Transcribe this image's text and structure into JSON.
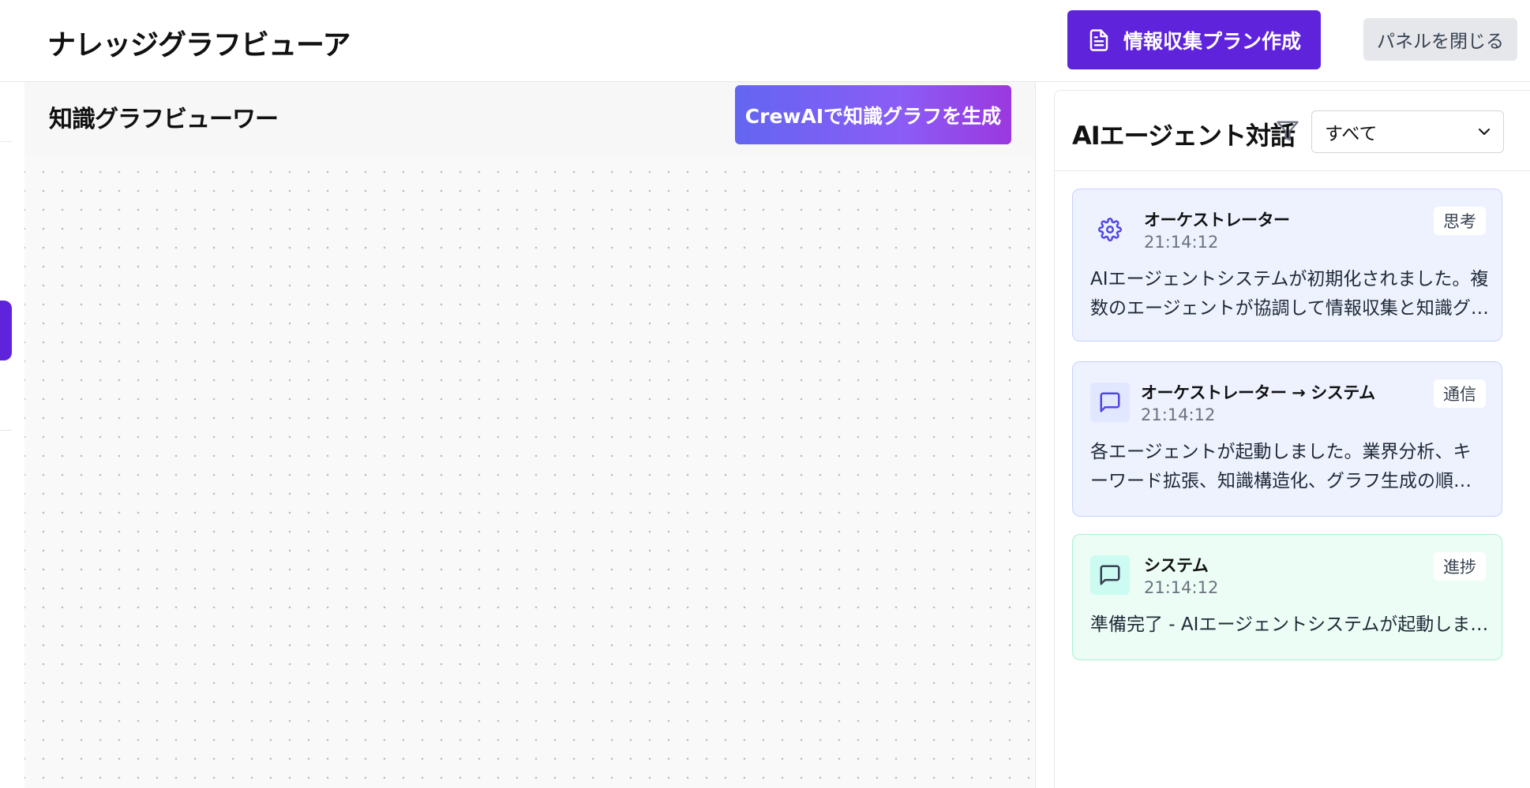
{
  "header": {
    "title": "ナレッジグラフビューア",
    "plan_button": "情報収集プラン作成",
    "close_panel_button": "パネルを閉じる"
  },
  "graph": {
    "title": "知識グラフビューワー",
    "generate_button": "CrewAIで知識グラフを生成"
  },
  "agent_panel": {
    "title": "AIエージェント対話",
    "filter": {
      "selected": "すべて"
    },
    "messages": [
      {
        "sender": "オーケストレーター",
        "time": "21:14:12",
        "badge": "思考",
        "body": "AIエージェントシステムが初期化されました。複数のエージェントが協調して情報収集と知識グラフの生成を行います。",
        "icon": "gear-icon",
        "tone": "blue"
      },
      {
        "sender": "オーケストレーター → システム",
        "time": "21:14:12",
        "badge": "通信",
        "body": "各エージェントが起動しました。業界分析、キーワード拡張、知識構造化、グラフ生成の順に処理を行います。",
        "icon": "message-square-icon",
        "tone": "blue"
      },
      {
        "sender": "システム",
        "time": "21:14:12",
        "badge": "進捗",
        "body": "準備完了 - AIエージェントシステムが起動しました",
        "icon": "message-square-icon",
        "tone": "green"
      }
    ]
  },
  "colors": {
    "primary": "#6023dc",
    "gradient_start": "#6366f1",
    "gradient_end": "#9b38df",
    "message_blue_bg": "#eef2ff",
    "message_green_bg": "#ecfdf5"
  }
}
